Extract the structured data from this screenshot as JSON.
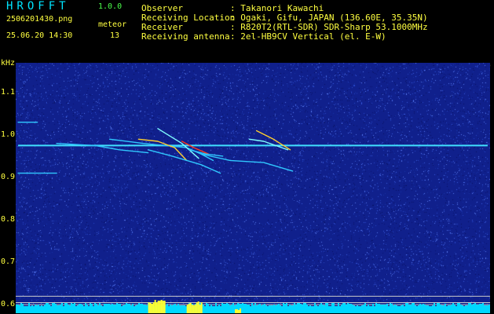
{
  "app": {
    "logo": "HROFFT",
    "version": "1.0.0",
    "filename": "2506201430.png",
    "datetime": "25.06.20 14:30",
    "meteor_label": "meteor",
    "meteor_count": "13"
  },
  "info": {
    "rows": [
      {
        "label": "Observer",
        "value": ": Takanori Kawachi"
      },
      {
        "label": "Receiving Location",
        "value": ": Ogaki, Gifu, JAPAN (136.60E, 35.35N)"
      },
      {
        "label": "Receiver",
        "value": ": R820T2(RTL-SDR) SDR-Sharp 53.1000MHz"
      },
      {
        "label": "Receiving antenna",
        "value": ": 2el-HB9CV Vertical (el. E-W)"
      }
    ]
  },
  "colors": {
    "background": "#000000",
    "spectrogram_bg": "#10208c",
    "carrier": "#40e0ff",
    "label_yellow": "#ffff40",
    "header_white": "#ffffff",
    "version_green": "#4cff4c",
    "bottom_bar_cyan": "#00d8ff",
    "bottom_bar_yellow": "#ffff30"
  },
  "chart_data": {
    "type": "heatmap",
    "title": "",
    "ylabel": "kHz",
    "xlabel": "",
    "x_ticks": [
      "1431",
      "1432",
      "1433",
      "1434",
      "1435",
      "1436",
      "1437",
      "1438",
      "1439",
      "1440"
    ],
    "y_ticks": [
      "1.1",
      "1.0",
      "0.9",
      "0.8",
      "0.7",
      "0.6"
    ],
    "x_range": [
      1430.35,
      1440.2
    ],
    "y_range": [
      0.58,
      1.17
    ],
    "carrier_khz": 0.975,
    "carrier_x_range": [
      1430.4,
      1440.15
    ],
    "meteor_traces": [
      {
        "x": [
          1432.3,
          1433.0,
          1433.9,
          1434.2,
          1434.45
        ],
        "y": [
          0.99,
          0.98,
          0.97,
          0.955,
          0.94
        ],
        "color": "#30c8ff"
      },
      {
        "x": [
          1432.9,
          1433.3,
          1433.65,
          1433.9
        ],
        "y": [
          0.99,
          0.985,
          0.97,
          0.94
        ],
        "color": "#ffd030"
      },
      {
        "x": [
          1433.3,
          1433.8,
          1434.15
        ],
        "y": [
          1.015,
          0.98,
          0.945
        ],
        "color": "#80ffff"
      },
      {
        "x": [
          1433.8,
          1434.05,
          1434.35
        ],
        "y": [
          0.985,
          0.97,
          0.955
        ],
        "color": "#ff3c1c"
      },
      {
        "x": [
          1433.1,
          1433.6,
          1434.2,
          1434.6
        ],
        "y": [
          0.965,
          0.95,
          0.93,
          0.91
        ],
        "color": "#30c8ff"
      },
      {
        "x": [
          1434.2,
          1434.8,
          1435.5,
          1436.1
        ],
        "y": [
          0.955,
          0.94,
          0.935,
          0.915
        ],
        "color": "#30c8ff"
      },
      {
        "x": [
          1433.95,
          1434.3,
          1434.65
        ],
        "y": [
          0.965,
          0.955,
          0.95
        ],
        "color": "#30c8ff"
      },
      {
        "x": [
          1431.2,
          1432.0,
          1432.5,
          1433.1
        ],
        "y": [
          0.98,
          0.975,
          0.965,
          0.958
        ],
        "color": "#30c8ff"
      },
      {
        "x": [
          1435.2,
          1435.5,
          1435.75,
          1436.0
        ],
        "y": [
          0.99,
          0.985,
          0.975,
          0.965
        ],
        "color": "#80ffff"
      },
      {
        "x": [
          1435.35,
          1435.7,
          1436.05
        ],
        "y": [
          1.01,
          0.99,
          0.965
        ],
        "color": "#ffd030"
      },
      {
        "x": [
          1430.4,
          1430.8
        ],
        "y": [
          1.03,
          1.03
        ],
        "color": "#30c8ff"
      },
      {
        "x": [
          1430.4,
          1431.2
        ],
        "y": [
          0.91,
          0.91
        ],
        "color": "#30c8ff"
      }
    ],
    "bottom_guides_khz": [
      0.62,
      0.605,
      0.6
    ],
    "activity_bars": [
      {
        "x": [
          1433.1,
          1433.45
        ],
        "height": 0.85,
        "color": "#ffff30"
      },
      {
        "x": [
          1433.9,
          1434.2
        ],
        "height": 0.8,
        "color": "#ffff30"
      },
      {
        "x": [
          1434.9,
          1435.0
        ],
        "height": 0.3,
        "color": "#ffff30"
      }
    ],
    "grid": false
  }
}
